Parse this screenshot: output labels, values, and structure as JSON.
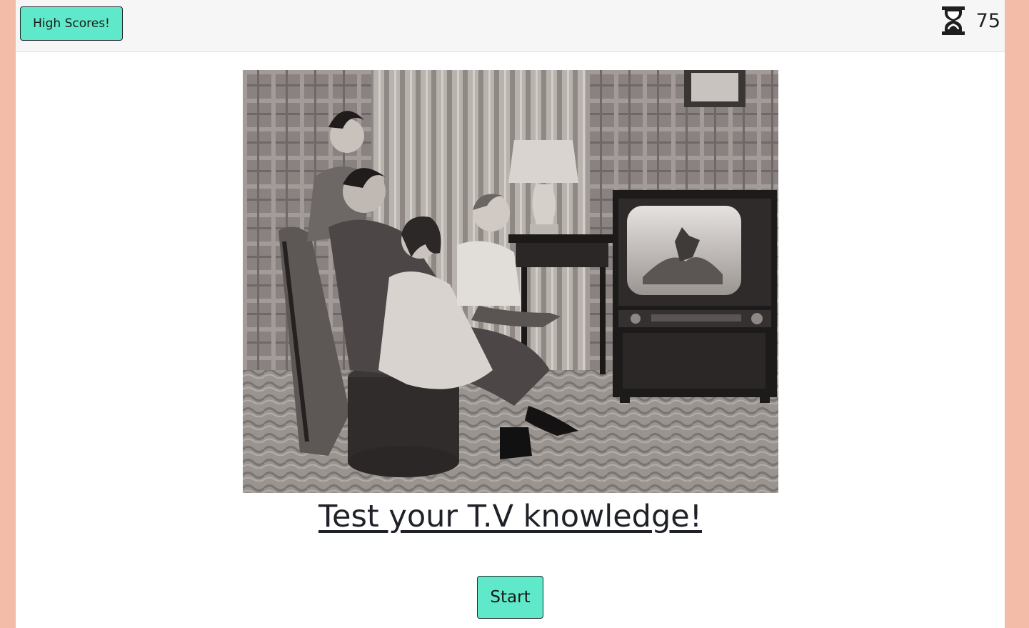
{
  "navbar": {
    "high_scores_label": "High Scores!",
    "timer_icon": "hourglass-icon",
    "timer_value": "75"
  },
  "hero": {
    "image": "vintage-family-watching-tv-photo"
  },
  "main": {
    "title": "Test your T.V knowledge!",
    "start_label": "Start"
  },
  "colors": {
    "accent_button": "#5fe8c9",
    "page_border": "#f2bca8",
    "navbar_bg": "#f6f6f6"
  }
}
